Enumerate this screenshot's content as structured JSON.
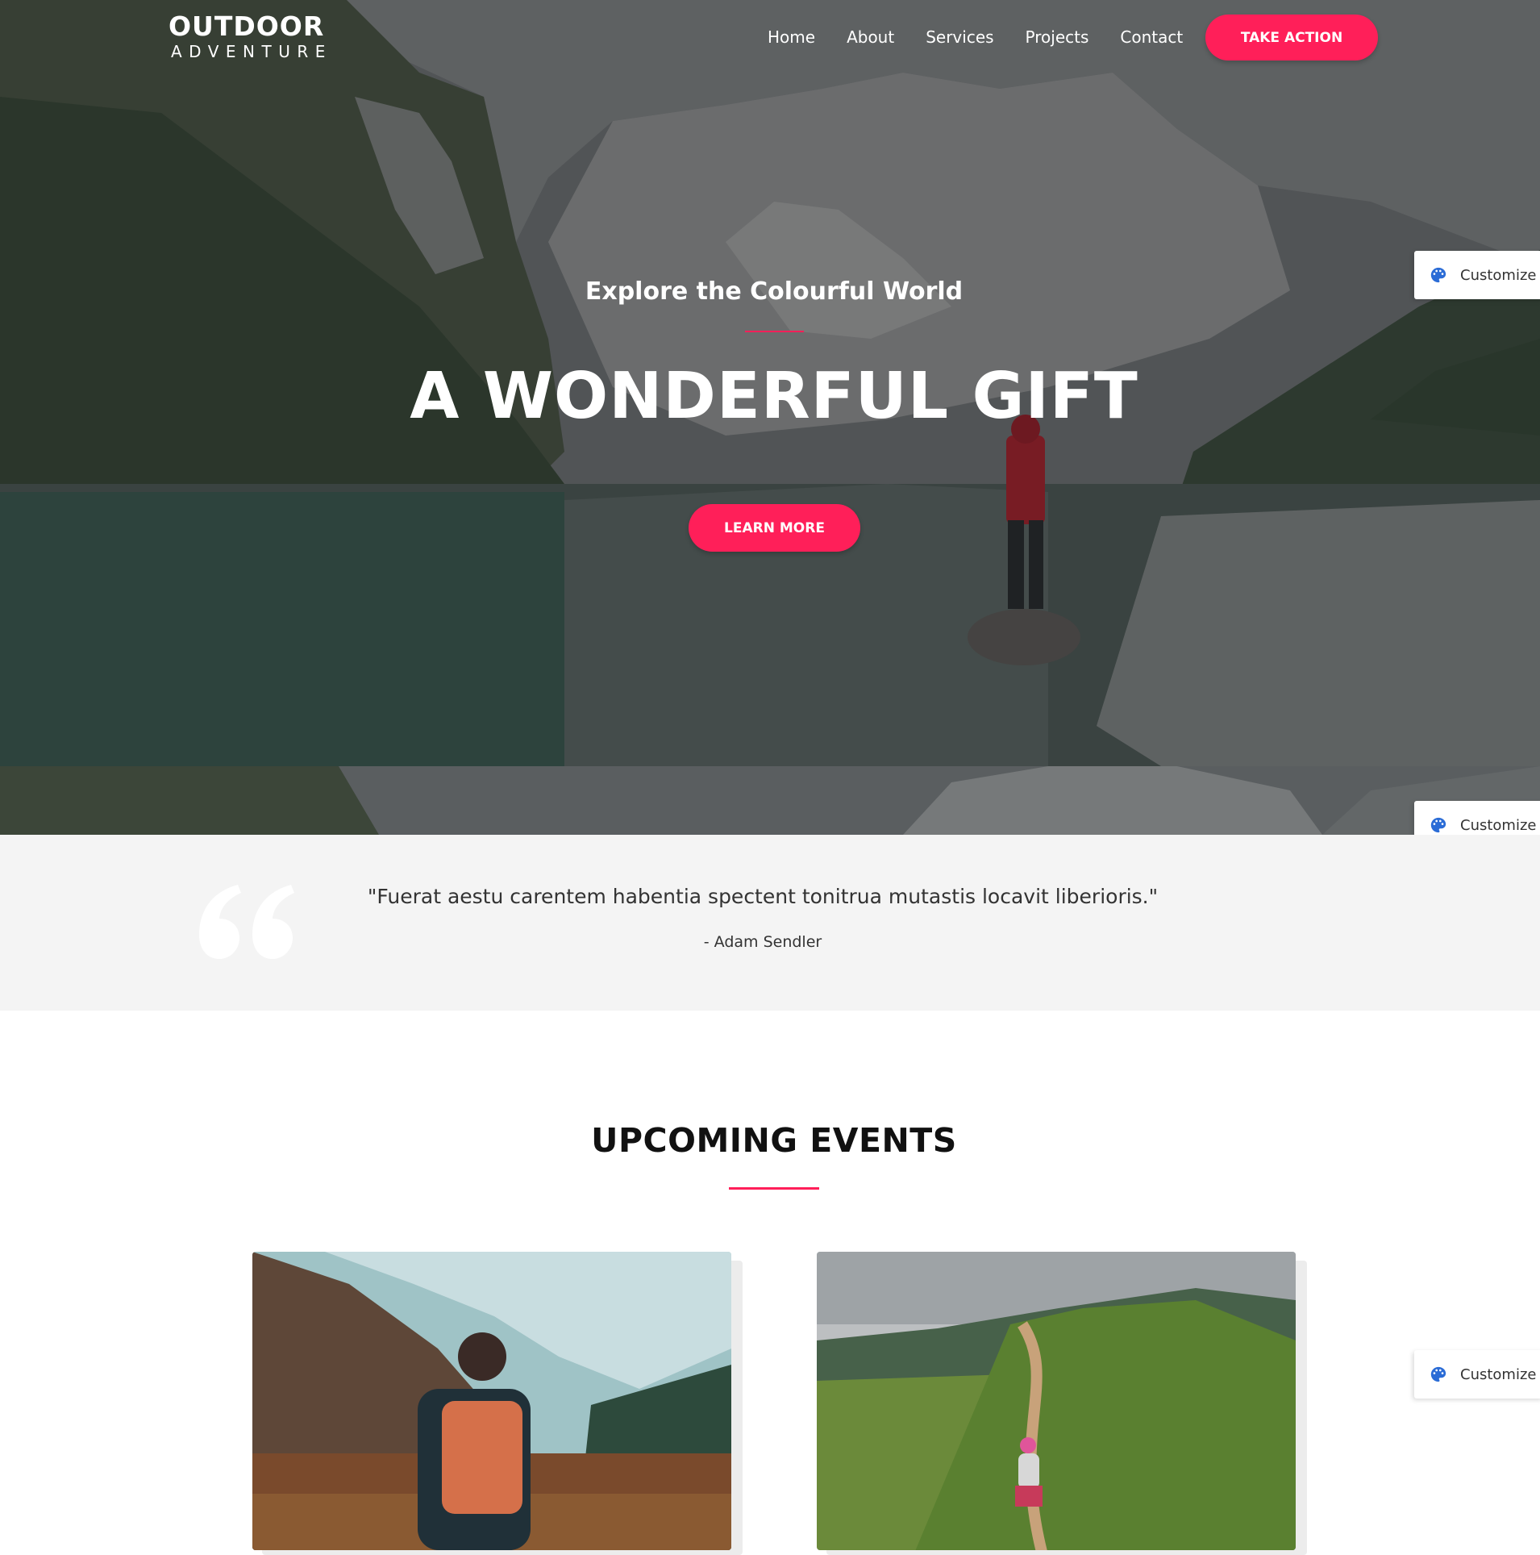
{
  "logo": {
    "line1": "OUTDOOR",
    "line2": "ADVENTURE"
  },
  "nav": {
    "items": [
      "Home",
      "About",
      "Services",
      "Projects",
      "Contact"
    ]
  },
  "header": {
    "cta_label": "TAKE ACTION"
  },
  "hero": {
    "subtitle": "Explore the Colourful World",
    "title": "A WONDERFUL GIFT",
    "button_label": "LEARN MORE"
  },
  "customize": {
    "label": "Customize"
  },
  "quote": {
    "text": "\"Fuerat aestu carentem habentia spectent tonitrua mutastis locavit liberioris.\"",
    "author": "- Adam Sendler"
  },
  "events": {
    "title": "UPCOMING EVENTS"
  },
  "colors": {
    "accent": "#ff1f59",
    "quote_bg": "#f4f4f4",
    "customize_icon": "#2b6cd6"
  }
}
